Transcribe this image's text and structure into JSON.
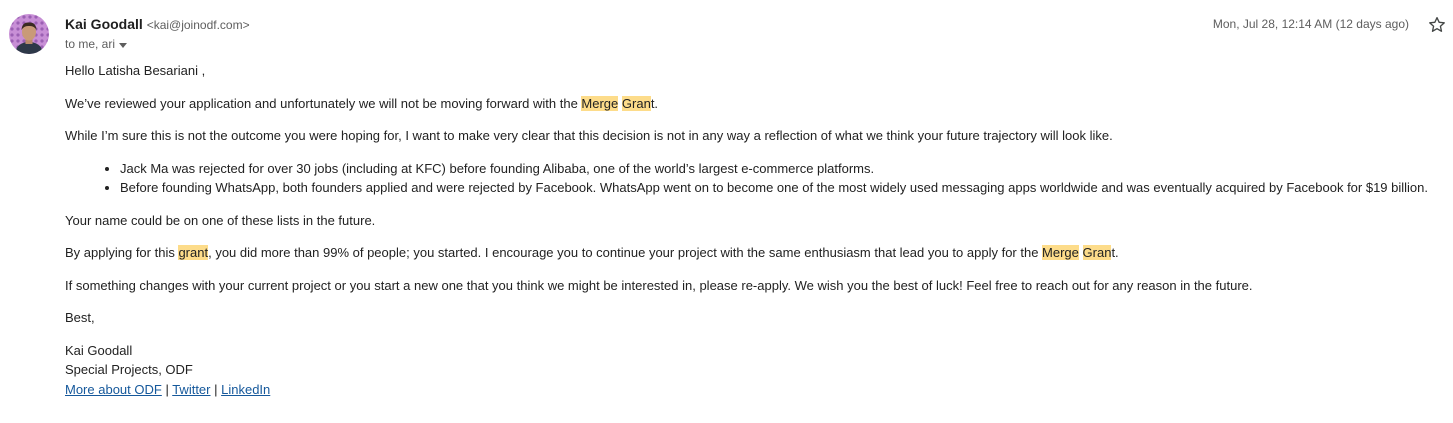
{
  "email": {
    "sender": {
      "name": "Kai Goodall",
      "email": "<kai@joinodf.com>"
    },
    "recipients_text": "to me, ari",
    "date": "Mon, Jul 28, 12:14 AM (12 days ago)",
    "body": {
      "greeting": "Hello Latisha Besariani ,",
      "p1": {
        "prefix": "We’ve reviewed your application and unfortunately we will not be moving forward with the ",
        "hl1": "Merge",
        "space": " ",
        "hl2": "Gran",
        "suffix": "t."
      },
      "p2": "While I’m sure this is not the outcome you were hoping for, I want to make very clear that this decision is not in any way a reflection of what we think your future trajectory will look like.",
      "bullets": [
        "Jack Ma was rejected for over 30 jobs (including at KFC) before founding Alibaba, one of the world’s largest e-commerce platforms.",
        "Before founding WhatsApp, both founders applied and were rejected by Facebook. WhatsApp went on to become one of the most widely used messaging apps worldwide and was eventually acquired by Facebook for $19 billion."
      ],
      "p3": "Your name could be on one of these lists in the future.",
      "p4": {
        "prefix": "By applying for this ",
        "hl1": "grant",
        "middle": ", you did more than 99% of people; you started. I encourage you to continue your project with the same enthusiasm that lead you to apply for the ",
        "hl2": "Merge",
        "space": " ",
        "hl3": "Gran",
        "suffix": "t."
      },
      "p5": "If something changes with your current project or you start a new one that you think we might be interested in, please re-apply. We wish you the best of luck! Feel free to reach out for any reason in the future.",
      "closing": "Best,",
      "signature": {
        "name": "Kai Goodall",
        "title": "Special Projects, ODF",
        "links": {
          "about": "More about ODF",
          "sep1": " | ",
          "twitter": "Twitter",
          "sep2": " | ",
          "linkedin": "LinkedIn"
        }
      }
    }
  },
  "colors": {
    "highlight": "#fddc8a",
    "link": "#15589b",
    "avatar_bg": "#c88fd6"
  },
  "icons": {
    "star": "star-outline-icon",
    "dropdown": "chevron-down-icon",
    "avatar": "avatar-image"
  }
}
